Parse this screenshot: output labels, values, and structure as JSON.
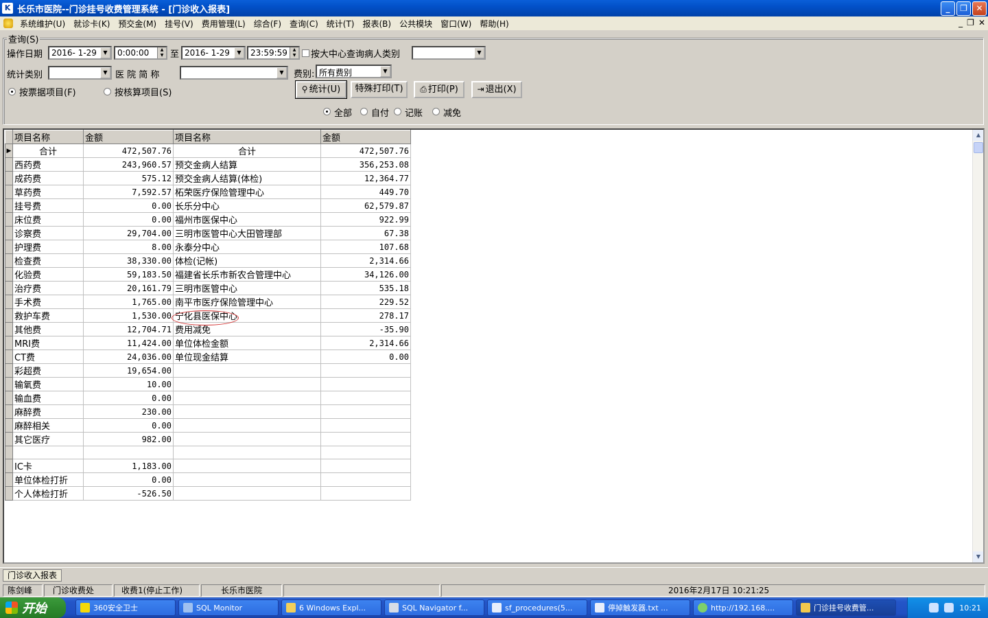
{
  "window": {
    "title": "长乐市医院--门诊挂号收费管理系统 - [门诊收入报表]",
    "icon_label": "K",
    "controls": [
      "_",
      "❐",
      "✕"
    ]
  },
  "menu": {
    "items": [
      "系统维护(U)",
      "就诊卡(K)",
      "预交金(M)",
      "挂号(V)",
      "费用管理(L)",
      "综合(F)",
      "查询(C)",
      "统计(T)",
      "报表(B)",
      "公共模块",
      "窗口(W)",
      "帮助(H)"
    ],
    "mdi_controls": [
      "_",
      "❐",
      "✕"
    ]
  },
  "query": {
    "group_title": "查询(S)",
    "date_label": "操作日期",
    "start_date": "2016- 1-29",
    "start_time": "0:00:00",
    "to_label": "至",
    "end_date": "2016- 1-29",
    "end_time": "23:59:59",
    "center_checkbox_label": "按大中心查询病人类别",
    "center_value": "",
    "stat_type_label": "统计类别",
    "stat_type_value": "",
    "hospital_label": "医 院 简 称",
    "hospital_value": "",
    "fee_label": "费别:",
    "fee_value": "所有费别",
    "radio_receipt": "按票据项目(F)",
    "radio_settle": "按核算项目(S)",
    "btn_stat": "统计(U)",
    "btn_special_print": "特殊打印(T)",
    "btn_print": "打印(P)",
    "btn_exit": "退出(X)",
    "filter_all": "全部",
    "filter_self": "自付",
    "filter_account": "记账",
    "filter_waive": "减免"
  },
  "grid": {
    "headers": [
      "项目名称",
      "金额",
      "项目名称",
      "金额"
    ],
    "rows": [
      [
        "合计",
        "472,507.76",
        "合计",
        "472,507.76"
      ],
      [
        "西药费",
        "243,960.57",
        "预交金病人结算",
        "356,253.08"
      ],
      [
        "成药费",
        "575.12",
        "预交金病人结算(体检)",
        "12,364.77"
      ],
      [
        "草药费",
        "7,592.57",
        "柘荣医疗保险管理中心",
        "449.70"
      ],
      [
        "挂号费",
        "0.00",
        "长乐分中心",
        "62,579.87"
      ],
      [
        "床位费",
        "0.00",
        "福州市医保中心",
        "922.99"
      ],
      [
        "诊察费",
        "29,704.00",
        "三明市医管中心大田管理部",
        "67.38"
      ],
      [
        "护理费",
        "8.00",
        "永泰分中心",
        "107.68"
      ],
      [
        "检查费",
        "38,330.00",
        "体检(记帐)",
        "2,314.66"
      ],
      [
        "化验费",
        "59,183.50",
        "福建省长乐市新农合管理中心",
        "34,126.00"
      ],
      [
        "治疗费",
        "20,161.79",
        "三明市医管中心",
        "535.18"
      ],
      [
        "手术费",
        "1,765.00",
        "南平市医疗保险管理中心",
        "229.52"
      ],
      [
        "救护车费",
        "1,530.00",
        "宁化县医保中心",
        "278.17"
      ],
      [
        "其他费",
        "12,704.71",
        "费用减免",
        "-35.90"
      ],
      [
        "MRI费",
        "11,424.00",
        "单位体检金额",
        "2,314.66"
      ],
      [
        "CT费",
        "24,036.00",
        "单位现金结算",
        "0.00"
      ],
      [
        "彩超费",
        "19,654.00",
        "",
        ""
      ],
      [
        "输氧费",
        "10.00",
        "",
        ""
      ],
      [
        "输血费",
        "0.00",
        "",
        ""
      ],
      [
        "麻醉费",
        "230.00",
        "",
        ""
      ],
      [
        "麻醉相关",
        "0.00",
        "",
        ""
      ],
      [
        "其它医疗",
        "982.00",
        "",
        ""
      ],
      [
        "",
        "",
        "",
        ""
      ],
      [
        "IC卡",
        "1,183.00",
        "",
        ""
      ],
      [
        "单位体检打折",
        "0.00",
        "",
        ""
      ],
      [
        "个人体检打折",
        "-526.50",
        "",
        ""
      ]
    ]
  },
  "doc_tab": "门诊收入报表",
  "status": {
    "user": "陈剑峰",
    "office": "门诊收费处",
    "station": "收费1(停止工作)",
    "hospital": "长乐市医院",
    "datetime": "2016年2月17日  10:21:25"
  },
  "taskbar": {
    "start": "开始",
    "tasks": [
      "360安全卫士",
      "SQL Monitor",
      "6 Windows Expl...",
      "SQL Navigator f...",
      "sf_procedures(5...",
      "停掉触发器.txt ...",
      "http://192.168....",
      "门诊挂号收费管..."
    ],
    "clock": "10:21"
  },
  "colors": {
    "titlebar": "#0250c8",
    "taskbar": "#2456c8",
    "annotation": "#d23030"
  }
}
